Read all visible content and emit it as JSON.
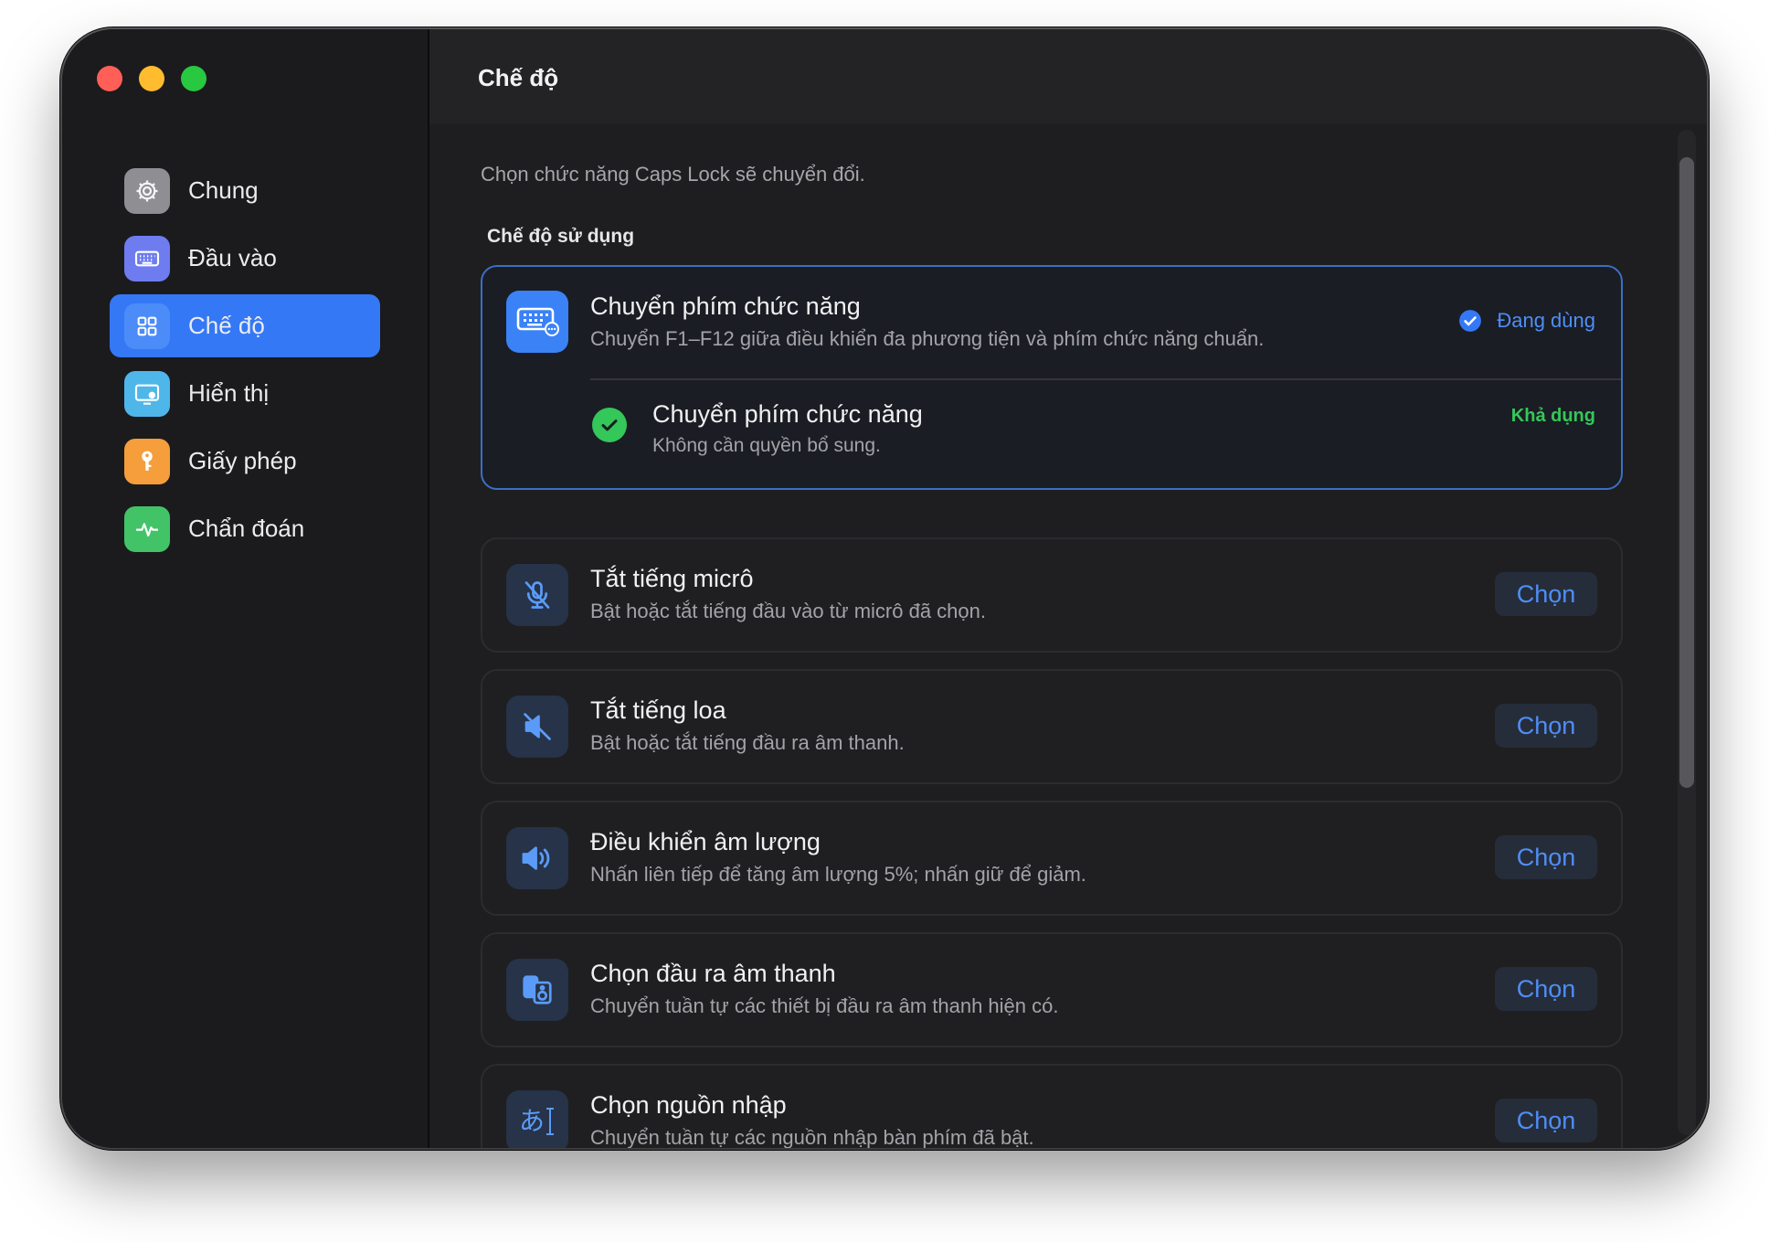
{
  "window": {
    "title": "Chế độ"
  },
  "sidebar": {
    "items": [
      {
        "label": "Chung",
        "icon": "gear-icon"
      },
      {
        "label": "Đầu vào",
        "icon": "keyboard-icon"
      },
      {
        "label": "Chế độ",
        "icon": "grid-icon",
        "selected": true
      },
      {
        "label": "Hiển thị",
        "icon": "display-icon"
      },
      {
        "label": "Giấy phép",
        "icon": "key-icon"
      },
      {
        "label": "Chẩn đoán",
        "icon": "pulse-icon"
      }
    ]
  },
  "main": {
    "subtitle": "Chọn chức năng Caps Lock sẽ chuyển đổi.",
    "section_title": "Chế độ sử dụng",
    "active_mode": {
      "title": "Chuyển phím chức năng",
      "description": "Chuyển F1–F12 giữa điều khiển đa phương tiện và phím chức năng chuẩn.",
      "status": "Đang dùng",
      "icon": "function-keyboard-icon",
      "requirement": {
        "title": "Chuyển phím chức năng",
        "description": "Không cần quyền bổ sung.",
        "status": "Khả dụng"
      }
    },
    "modes": [
      {
        "title": "Tắt tiếng micrô",
        "description": "Bật hoặc tắt tiếng đầu vào từ micrô đã chọn.",
        "button": "Chọn",
        "icon": "mic-slash-icon"
      },
      {
        "title": "Tắt tiếng loa",
        "description": "Bật hoặc tắt tiếng đầu ra âm thanh.",
        "button": "Chọn",
        "icon": "speaker-slash-icon"
      },
      {
        "title": "Điều khiển âm lượng",
        "description": "Nhấn liên tiếp để tăng âm lượng 5%; nhấn giữ để giảm.",
        "button": "Chọn",
        "icon": "speaker-wave-icon"
      },
      {
        "title": "Chọn đầu ra âm thanh",
        "description": "Chuyển tuần tự các thiết bị đầu ra âm thanh hiện có.",
        "button": "Chọn",
        "icon": "speakers-icon"
      },
      {
        "title": "Chọn nguồn nhập",
        "description": "Chuyển tuần tự các nguồn nhập bàn phím đã bật.",
        "button": "Chọn",
        "icon": "input-source-icon",
        "icon_text": "あ"
      }
    ]
  },
  "colors": {
    "accent": "#3478f6",
    "success": "#34c759",
    "background": "#1e1e20",
    "sidebar": "#1b1b1d"
  }
}
